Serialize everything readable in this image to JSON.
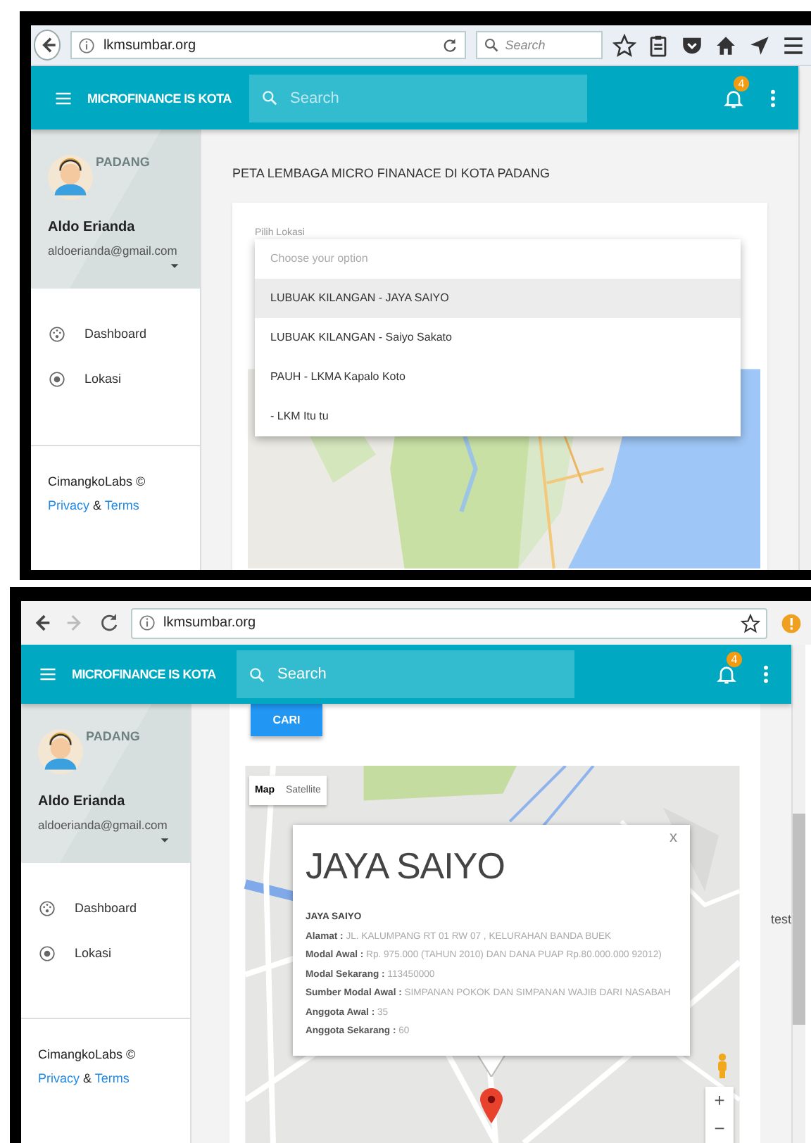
{
  "screens": [
    {
      "browser": {
        "kind": "firefox",
        "url": "lkmsumbar.org",
        "search_placeholder": "Search"
      },
      "header": {
        "title": "MICROFINANCE IS KOTA",
        "search_placeholder": "Search",
        "notification_count": "4"
      },
      "sidebar": {
        "region": "PADANG",
        "user_name": "Aldo Erianda",
        "user_email": "aldoerianda@gmail.com",
        "items": [
          {
            "kind": "dashboard",
            "label": "Dashboard"
          },
          {
            "kind": "location",
            "label": "Lokasi"
          }
        ],
        "footer": {
          "brand": "CimangkoLabs ©",
          "privacy": "Privacy",
          "joiner": "&",
          "terms": "Terms"
        }
      },
      "content": {
        "kind": "location_select",
        "title": "PETA LEMBAGA MICRO FINANACE DI KOTA PADANG",
        "field_label": "Pilih Lokasi",
        "dropdown": {
          "placeholder": "Choose your option",
          "options": [
            {
              "label": "LUBUAK KILANGAN - JAYA SAIYO",
              "selected": true
            },
            {
              "label": "LUBUAK KILANGAN - Saiyo Sakato",
              "selected": false
            },
            {
              "label": "PAUH - LKMA Kapalo Koto",
              "selected": false
            },
            {
              "label": "- LKM Itu tu",
              "selected": false
            }
          ]
        }
      }
    },
    {
      "browser": {
        "kind": "chrome",
        "url": "lkmsumbar.org"
      },
      "header": {
        "title": "MICROFINANCE IS KOTA",
        "search_placeholder": "Search",
        "notification_count": "4"
      },
      "sidebar": {
        "region": "PADANG",
        "user_name": "Aldo Erianda",
        "user_email": "aldoerianda@gmail.com",
        "items": [
          {
            "kind": "dashboard",
            "label": "Dashboard"
          },
          {
            "kind": "location",
            "label": "Lokasi"
          }
        ],
        "footer": {
          "brand": "CimangkoLabs ©",
          "privacy": "Privacy",
          "joiner": "&",
          "terms": "Terms"
        }
      },
      "content": {
        "kind": "map_result",
        "button": "CARI",
        "map_types": [
          {
            "label": "Map",
            "selected": true
          },
          {
            "label": "Satellite",
            "selected": false
          }
        ],
        "info_window": {
          "close": "x",
          "heading": "JAYA SAIYO",
          "name": "JAYA SAIYO",
          "fields": [
            {
              "label": "Alamat :",
              "value": "JL. KALUMPANG RT 01 RW 07 , KELURAHAN BANDA BUEK"
            },
            {
              "label": "Modal Awal :",
              "value": "Rp. 975.000 (TAHUN 2010) DAN DANA PUAP Rp.80.000.000 92012)"
            },
            {
              "label": "Modal Sekarang :",
              "value": "113450000"
            },
            {
              "label": "Sumber Modal Awal :",
              "value": "SIMPANAN POKOK DAN SIMPANAN WAJIB DARI NASABAH"
            },
            {
              "label": "Anggota Awal :",
              "value": "35"
            },
            {
              "label": "Anggota Sekarang :",
              "value": "60"
            }
          ]
        },
        "zoom_controls": [
          "+",
          "−"
        ],
        "side_note": "test"
      }
    }
  ]
}
